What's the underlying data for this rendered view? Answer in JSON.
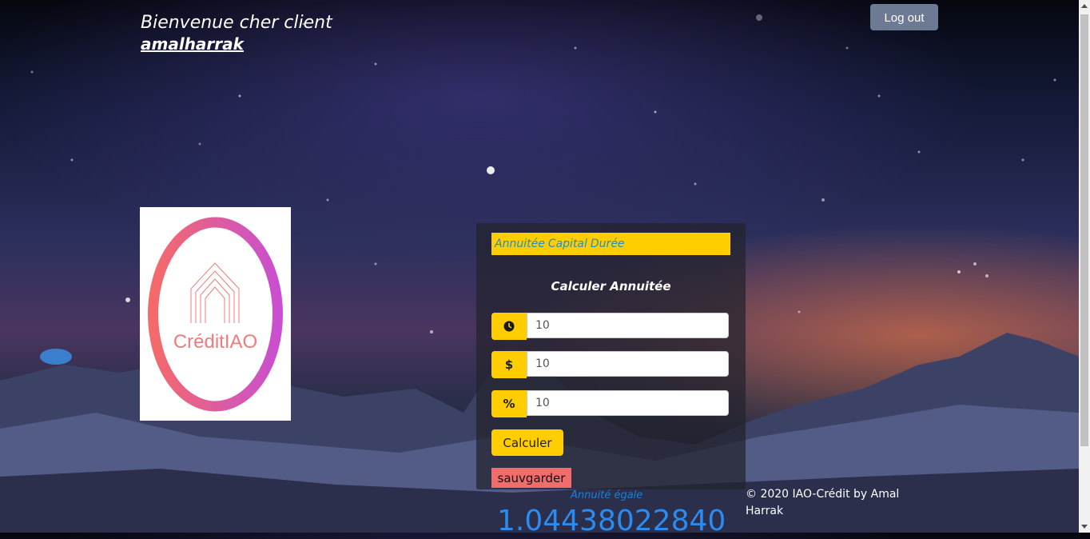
{
  "header": {
    "welcome_text": "Bienvenue cher client",
    "username": "amalharrak",
    "logout_label": "Log out"
  },
  "logo": {
    "text": "CréditIAO"
  },
  "panel": {
    "tabs": [
      "Annuitée",
      "Capital",
      "Durée"
    ],
    "title": "Calculer Annuitée",
    "fields": [
      {
        "icon": "clock-icon",
        "value": "10"
      },
      {
        "icon": "dollar-icon",
        "symbol": "$",
        "value": "10"
      },
      {
        "icon": "percent-icon",
        "symbol": "%",
        "value": "10"
      }
    ],
    "calculate_label": "Calculer",
    "save_label": "sauvgarder"
  },
  "result": {
    "label": "Annuité égale",
    "value": "1.04438022840"
  },
  "footer": {
    "text": "© 2020 IAO-Crédit by Amal Harrak"
  },
  "colors": {
    "accent_yellow": "#ffcd00",
    "tab_text_blue": "#1f8fc9",
    "save_red": "#f26c6c",
    "logout_gray": "#6c7a94",
    "result_blue": "#2a8bf0"
  }
}
